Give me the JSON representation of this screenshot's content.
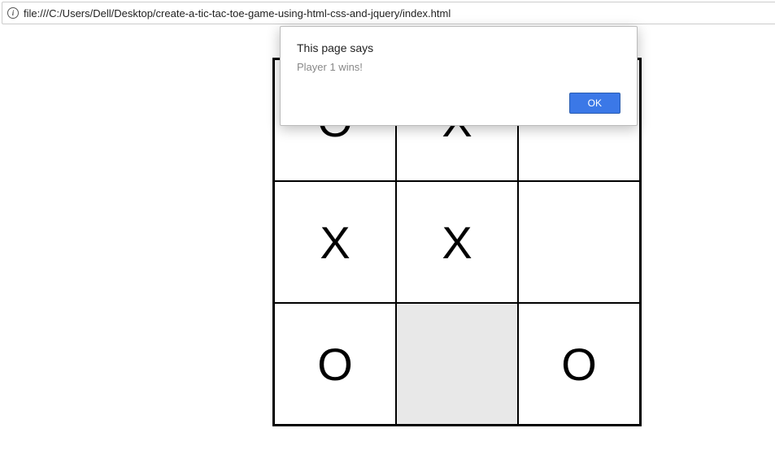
{
  "address_bar": {
    "url": "file:///C:/Users/Dell/Desktop/create-a-tic-tac-toe-game-using-html-css-and-jquery/index.html"
  },
  "dialog": {
    "title": "This page says",
    "message": "Player 1 wins!",
    "ok_label": "OK"
  },
  "board": {
    "cells": [
      [
        "O",
        "X",
        ""
      ],
      [
        "X",
        "X",
        ""
      ],
      [
        "O",
        "",
        "O"
      ]
    ],
    "hovered_cell": {
      "row": 2,
      "col": 1
    }
  }
}
